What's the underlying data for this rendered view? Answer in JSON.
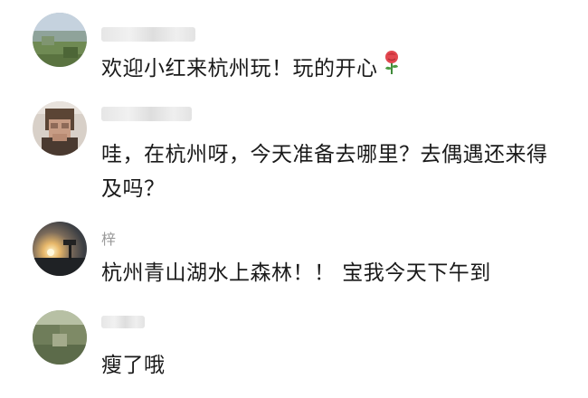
{
  "comments": [
    {
      "username": "",
      "text": "欢迎小红来杭州玩！玩的开心",
      "emoji": "rose-icon"
    },
    {
      "username": "",
      "text": "哇，在杭州呀，今天准备去哪里？去偶遇还来得及吗？"
    },
    {
      "username": "梓",
      "text": "杭州青山湖水上森林！！ 宝我今天下午到"
    },
    {
      "username": "",
      "text": "瘦了哦"
    }
  ],
  "colors": {
    "text": "#1a1a1a",
    "username": "#9a9a9a",
    "background": "#ffffff"
  }
}
